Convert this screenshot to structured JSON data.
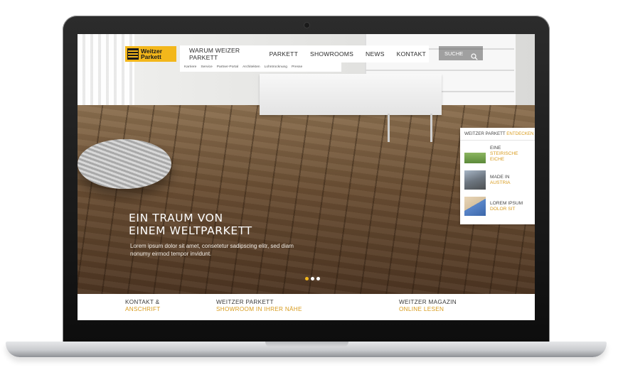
{
  "brand": {
    "logo_text": "Weitzer\nParkett",
    "accent_color": "#f3b71b",
    "accent_text_color": "#d89b1c"
  },
  "nav": {
    "items": [
      {
        "label": "WARUM WEIZER PARKETT"
      },
      {
        "label": "PARKETT"
      },
      {
        "label": "SHOWROOMS"
      },
      {
        "label": "NEWS"
      },
      {
        "label": "KONTAKT"
      }
    ],
    "subnav": [
      {
        "label": "Karriere"
      },
      {
        "label": "Service"
      },
      {
        "label": "Partner-Portal"
      },
      {
        "label": "Architekten"
      },
      {
        "label": "Lohntrocknung"
      },
      {
        "label": "Presse"
      }
    ]
  },
  "search": {
    "label": "SUCHE",
    "icon": "search-icon"
  },
  "hero": {
    "title": "EIN TRAUM VON\nEINEM WELTPARKETT",
    "subtitle": "Lorem ipsum dolor sit amet, consetetur sadipscing elitr, sed diam nonumy eirmod tempor invidunt.",
    "slides": {
      "count": 3,
      "active_index": 0
    }
  },
  "discover": {
    "heading_prefix": "WEITZER PARKETT",
    "heading_accent": "ENTDECKEN",
    "items": [
      {
        "line1": "EINE",
        "line2": "STEIRISCHE\nEICHE"
      },
      {
        "line1": "MADE IN",
        "line2": "AUSTRIA"
      },
      {
        "line1": "LOREM IPSUM",
        "line2": "DOLOR SIT"
      }
    ]
  },
  "footer": {
    "links": [
      {
        "line1": "KONTAKT &",
        "line2": "ANSCHRIFT"
      },
      {
        "line1": "WEITZER PARKETT",
        "line2": "SHOWROOM IN IHRER NÄHE"
      },
      {
        "line1": "WEITZER MAGAZIN",
        "line2": "ONLINE LESEN"
      }
    ]
  }
}
